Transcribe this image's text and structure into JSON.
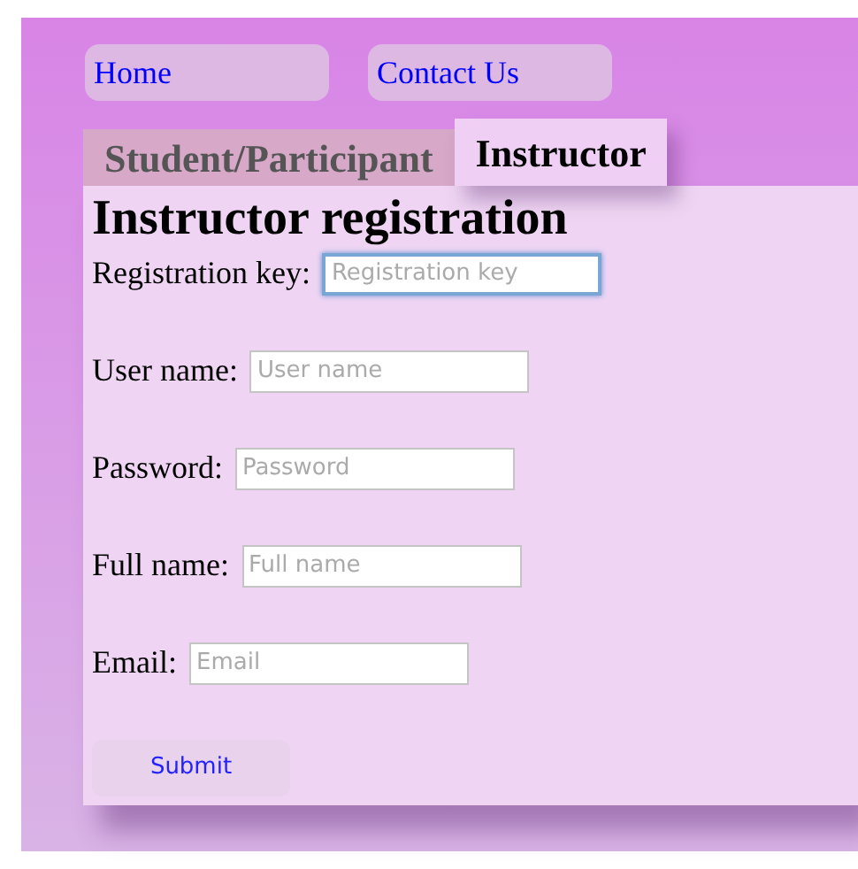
{
  "nav": [
    {
      "label": "Home"
    },
    {
      "label": "Contact Us"
    }
  ],
  "tabs": [
    {
      "label": "Student/Participant",
      "selected": false
    },
    {
      "label": "Instructor",
      "selected": true
    }
  ],
  "heading": "Instructor registration",
  "fields": [
    {
      "label": "Registration key:",
      "placeholder": "Registration key",
      "focused": true
    },
    {
      "label": "User name:",
      "placeholder": "User name",
      "focused": false
    },
    {
      "label": "Password:",
      "placeholder": "Password",
      "focused": false
    },
    {
      "label": "Full name:",
      "placeholder": "Full name",
      "focused": false
    },
    {
      "label": "Email:",
      "placeholder": "Email",
      "focused": false
    }
  ],
  "submit": "Submit"
}
